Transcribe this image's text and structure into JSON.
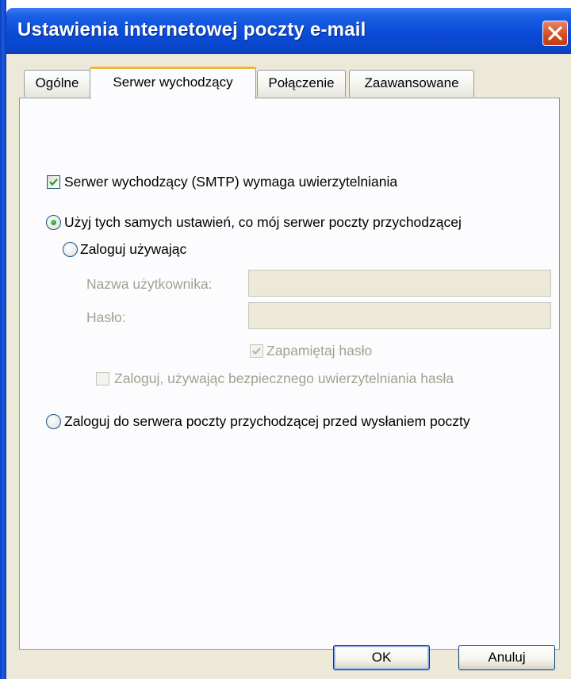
{
  "window": {
    "title": "Ustawienia internetowej poczty e-mail"
  },
  "tabs": [
    {
      "label": "Ogólne",
      "active": false
    },
    {
      "label": "Serwer wychodzący",
      "active": true
    },
    {
      "label": "Połączenie",
      "active": false
    },
    {
      "label": "Zaawansowane",
      "active": false
    }
  ],
  "smtp_auth": {
    "label": "Serwer wychodzący (SMTP) wymaga uwierzytelniania",
    "checked": true
  },
  "options": {
    "same_settings": {
      "label": "Użyj tych samych ustawień, co mój serwer poczty przychodzącej",
      "selected": true
    },
    "login_using": {
      "label": "Zaloguj używając",
      "selected": false
    },
    "login_before_send": {
      "label": "Zaloguj do serwera poczty przychodzącej przed wysłaniem poczty",
      "selected": false
    }
  },
  "credentials": {
    "username_label": "Nazwa użytkownika:",
    "username_value": "",
    "password_label": "Hasło:",
    "password_value": "",
    "remember_password": {
      "label": "Zapamiętaj hasło",
      "checked": true
    },
    "spa": {
      "label": "Zaloguj, używając bezpiecznego uwierzytelniania hasła",
      "checked": false
    }
  },
  "buttons": {
    "ok": "OK",
    "cancel": "Anuluj"
  },
  "colors": {
    "titlebar": "#0b4bd8",
    "dialog_bg": "#ece9d8",
    "active_tab_accent": "#f4b43c",
    "close_button": "#d24a22"
  }
}
